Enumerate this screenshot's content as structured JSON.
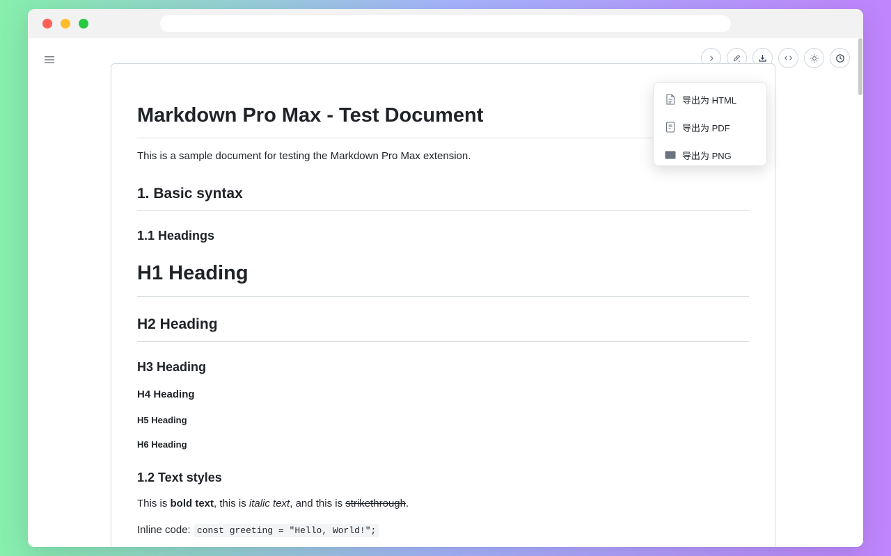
{
  "document": {
    "title": "Markdown Pro Max - Test Document",
    "intro": "This is a sample document for testing the Markdown Pro Max extension.",
    "section_basic": "1. Basic syntax",
    "sub_headings": "1.1 Headings",
    "h1": "H1 Heading",
    "h2": "H2 Heading",
    "h3": "H3 Heading",
    "h4": "H4 Heading",
    "h5": "H5 Heading",
    "h6": "H6 Heading",
    "sub_text_styles": "1.2 Text styles",
    "styles_line": {
      "prefix": "This is ",
      "bold": "bold text",
      "mid1": ", this is ",
      "italic": "italic text",
      "mid2": ", and this is ",
      "strike": "strikethrough",
      "suffix": "."
    },
    "inline_code_line": {
      "label": "Inline code: ",
      "code": "const greeting = \"Hello, World!\";"
    }
  },
  "export_menu": {
    "items": [
      {
        "label": "导出为 HTML",
        "icon": "file-text-icon"
      },
      {
        "label": "导出为 PDF",
        "icon": "file-pdf-icon"
      },
      {
        "label": "导出为 PNG",
        "icon": "image-icon"
      }
    ]
  },
  "toolbar": {
    "buttons": [
      "chevron-right-icon",
      "pen-icon",
      "download-icon",
      "code-icon",
      "sun-icon",
      "history-icon"
    ]
  },
  "colors": {
    "accent_border": "#d0d7de",
    "text": "#1f2328"
  }
}
